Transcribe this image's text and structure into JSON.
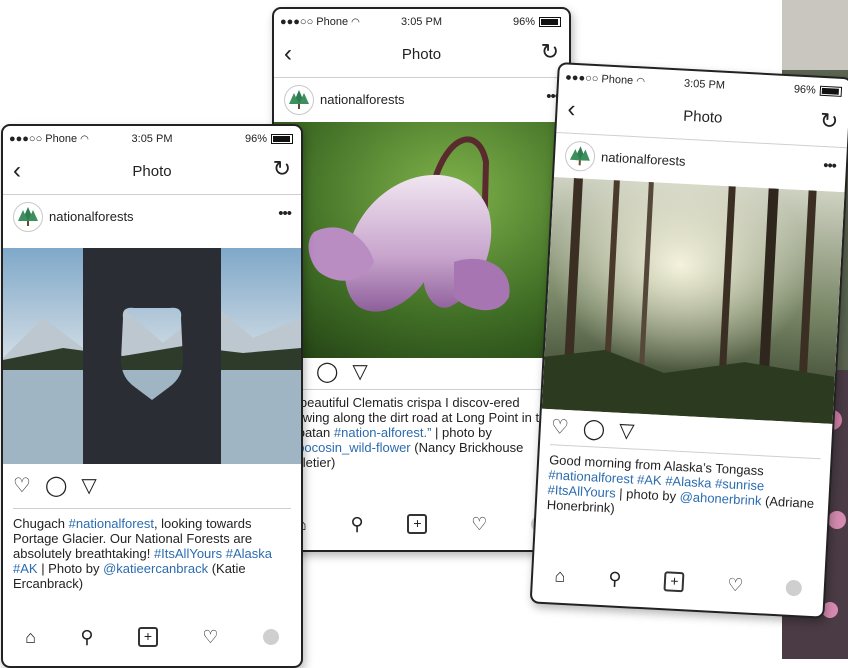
{
  "status": {
    "carrier": "●●●○○ Phone",
    "time": "3:05 PM",
    "battery": "96%"
  },
  "nav": {
    "title": "Photo"
  },
  "icons": {
    "back": "chevron-left-icon",
    "refresh": "refresh-icon",
    "more": "more-icon",
    "like": "heart-icon",
    "comment": "comment-icon",
    "share": "send-icon",
    "home": "home-icon",
    "search": "search-icon",
    "add": "add-icon",
    "activity": "heart-icon",
    "profile": "profile-icon"
  },
  "colors": {
    "hashtag": "#2b6cb0",
    "border": "#222222"
  },
  "posts": [
    {
      "username": "nationalforests",
      "caption_parts": [
        {
          "t": "Chugach ",
          "tag": false
        },
        {
          "t": "#nationalforest",
          "tag": true
        },
        {
          "t": ", looking towards Portage Glacier. Our National Forests are absolutely breathtaking! ",
          "tag": false
        },
        {
          "t": "#ItsAllYours",
          "tag": true
        },
        {
          "t": " ",
          "tag": false
        },
        {
          "t": "#Alaska #AK",
          "tag": true
        },
        {
          "t": " | Photo by ",
          "tag": false
        },
        {
          "t": "@katieercanbrack",
          "tag": true
        },
        {
          "t": " (Katie Ercanbrack)",
          "tag": false
        }
      ]
    },
    {
      "username": "nationalforests",
      "caption_parts": [
        {
          "t": "“A beautiful Clematis crispa I discov-ered growing along the dirt road at Long Point in the Croatan ",
          "tag": false
        },
        {
          "t": "#nation-alforest.”",
          "tag": true
        },
        {
          "t": " | photo by ",
          "tag": false
        },
        {
          "t": "@pocosin_wild-flower",
          "tag": true
        },
        {
          "t": " (Nancy Brickhouse Pelletier)",
          "tag": false
        }
      ]
    },
    {
      "username": "nationalforests",
      "caption_parts": [
        {
          "t": "Good morning from Alaska’s Tongass ",
          "tag": false
        },
        {
          "t": "#nationalforest #AK #Alaska #sunrise #ItsAllYours",
          "tag": true
        },
        {
          "t": " | photo by ",
          "tag": false
        },
        {
          "t": "@ahonerbrink",
          "tag": true
        },
        {
          "t": " (Adriane Honerbrink)",
          "tag": false
        }
      ]
    }
  ]
}
